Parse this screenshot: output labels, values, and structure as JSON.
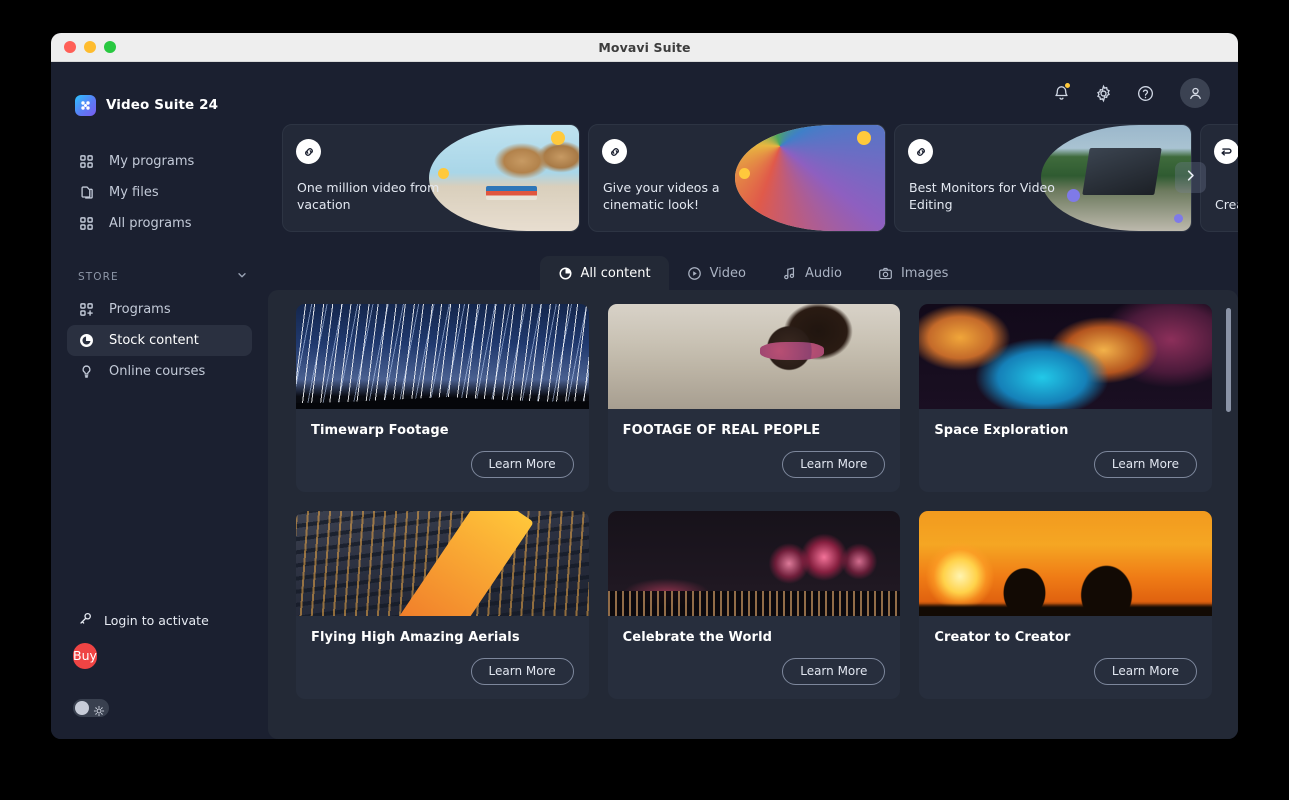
{
  "window": {
    "title": "Movavi Suite"
  },
  "brand": {
    "title": "Video Suite 24"
  },
  "sidebar": {
    "nav": [
      {
        "label": "My programs",
        "icon": "grid-icon"
      },
      {
        "label": "My files",
        "icon": "files-icon"
      },
      {
        "label": "All programs",
        "icon": "grid-icon"
      }
    ],
    "store_section": {
      "label": "STORE",
      "chevron": "chevron-down-icon"
    },
    "store_items": [
      {
        "label": "Programs",
        "icon": "grid-plus-icon",
        "active": false
      },
      {
        "label": "Stock content",
        "icon": "stock-icon",
        "active": true
      },
      {
        "label": "Online courses",
        "icon": "bulb-icon",
        "active": false
      }
    ],
    "login_label": "Login to activate",
    "login_icon": "key-icon",
    "buy_label": "Buy",
    "buy_color": "#ef4444",
    "theme_toggle_icon": "sun-icon"
  },
  "topbar": {
    "icons": [
      {
        "name": "bell-icon",
        "badge": true,
        "badge_color": "#ffc93c"
      },
      {
        "name": "gear-icon",
        "badge": false
      },
      {
        "name": "help-icon",
        "badge": false
      }
    ],
    "avatar_icon": "user-icon"
  },
  "banners": {
    "next_label": "chevron-right-icon",
    "items": [
      {
        "title": "One million video from vacation",
        "icon": "link-icon",
        "art": "img-beach"
      },
      {
        "title": "Give your videos a cinematic look!",
        "icon": "link-icon",
        "art": "img-colors"
      },
      {
        "title": "Best Monitors for Video Editing",
        "icon": "link-icon",
        "art": "img-laptop"
      },
      {
        "title": "Create Your Cartoons!",
        "icon": "loop-icon",
        "art": "img-cartoon"
      }
    ]
  },
  "tabs": [
    {
      "label": "All content",
      "icon": "stock-icon",
      "active": true
    },
    {
      "label": "Video",
      "icon": "play-circle-icon",
      "active": false
    },
    {
      "label": "Audio",
      "icon": "music-note-icon",
      "active": false
    },
    {
      "label": "Images",
      "icon": "camera-icon",
      "active": false
    }
  ],
  "content": {
    "learn_more_label": "Learn More",
    "cards": [
      {
        "title": "Timewarp Footage",
        "art": "img-stars"
      },
      {
        "title": "FOOTAGE OF REAL PEOPLE",
        "art": "img-people"
      },
      {
        "title": "Space Exploration",
        "art": "img-nebula"
      },
      {
        "title": "Flying High Amazing Aerials",
        "art": "img-city"
      },
      {
        "title": "Celebrate the World",
        "art": "img-fire"
      },
      {
        "title": "Creator to Creator",
        "art": "img-sunset"
      }
    ]
  }
}
